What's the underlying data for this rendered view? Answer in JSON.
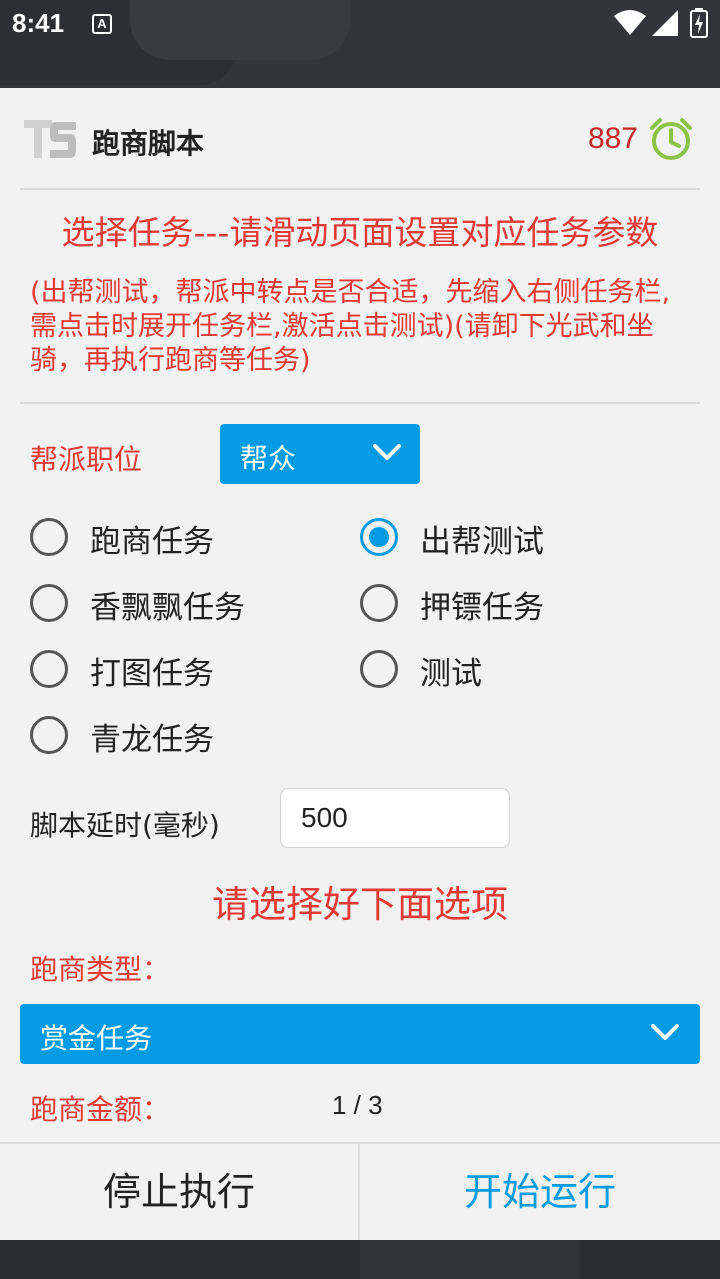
{
  "status_bar": {
    "time": "8:41",
    "notification_icon": "A"
  },
  "header": {
    "title": "跑商脚本",
    "counter": "887",
    "icons": {
      "logo": "ts-logo",
      "timer": "alarm-clock-icon"
    },
    "colors": {
      "counter": "#c62828",
      "timer": "#8bc34a"
    }
  },
  "heading": "选择任务---请滑动页面设置对应任务参数",
  "note": "(出帮测试，帮派中转点是否合适，先缩入右侧任务栏,需点击时展开任务栏,激活点击测试)(请卸下光武和坐骑，再执行跑商等任务)",
  "position": {
    "label": "帮派职位",
    "selected": "帮众"
  },
  "tasks": [
    {
      "label": "跑商任务",
      "checked": false
    },
    {
      "label": "出帮测试",
      "checked": true
    },
    {
      "label": "香飘飘任务",
      "checked": false
    },
    {
      "label": "押镖任务",
      "checked": false
    },
    {
      "label": "打图任务",
      "checked": false
    },
    {
      "label": "测试",
      "checked": false
    },
    {
      "label": "青龙任务",
      "checked": false
    }
  ],
  "delay": {
    "label": "脚本延时(毫秒)",
    "value": "500"
  },
  "select_prompt": "请选择好下面选项",
  "trade_type": {
    "label": "跑商类型：",
    "selected": "赏金任务"
  },
  "trade_amount": {
    "label": "跑商金额：",
    "value": "1 / 3"
  },
  "buttons": {
    "stop": "停止执行",
    "start": "开始运行"
  },
  "colors": {
    "accent": "#039be5",
    "warning_text": "#e53935",
    "background": "#f2f2f2"
  }
}
